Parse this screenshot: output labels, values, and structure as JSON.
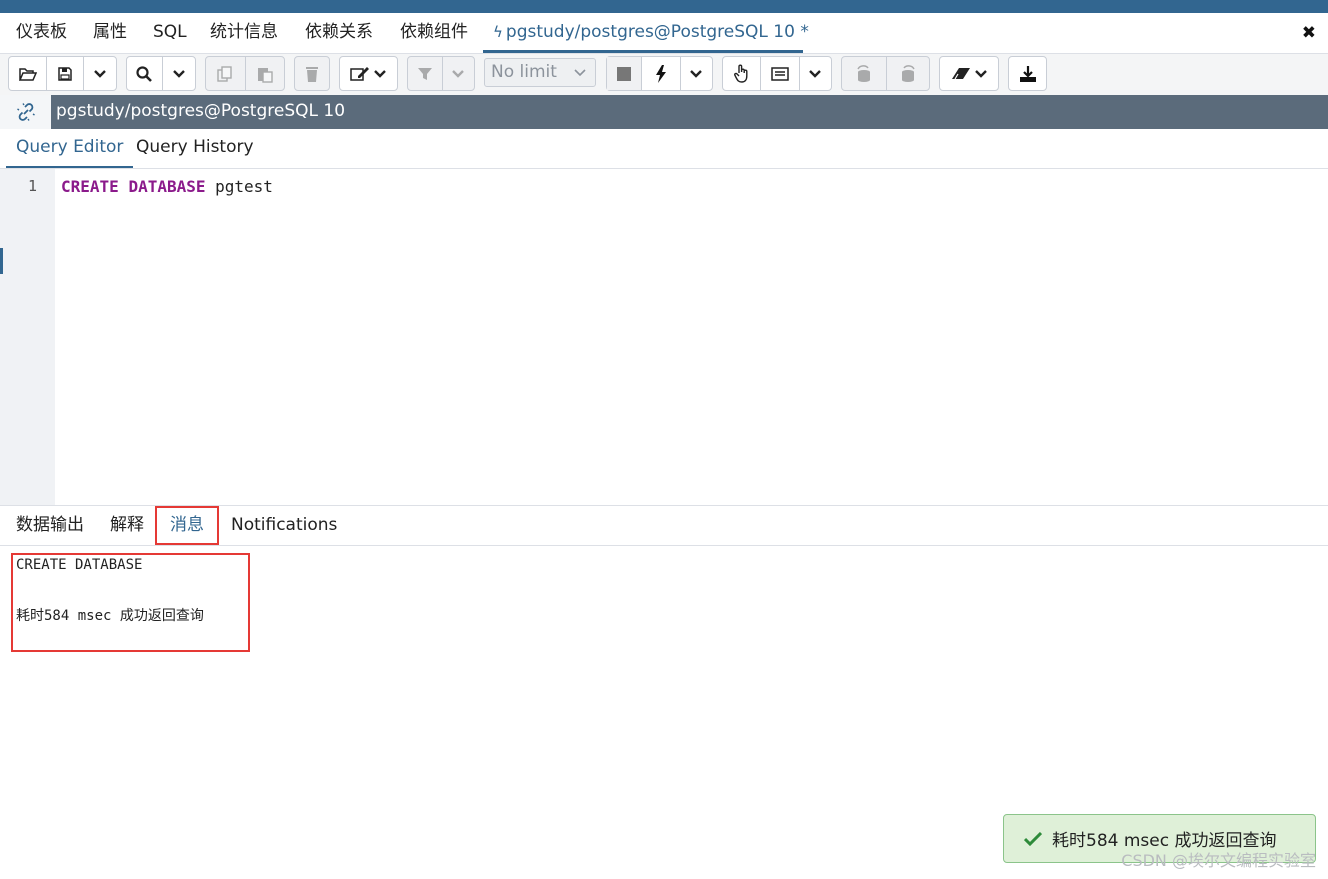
{
  "main_tabs": {
    "dashboard": "仪表板",
    "properties": "属性",
    "sql": "SQL",
    "statistics": "统计信息",
    "dependencies": "依赖关系",
    "dependents": "依赖组件",
    "query_tab": "pgstudy/postgres@PostgreSQL 10 *"
  },
  "toolbar": {
    "limit_value": "No limit",
    "icons": [
      "folder-open-icon",
      "save-icon",
      "chevron-down-icon",
      "search-icon",
      "chevron-down-icon",
      "copy-icon",
      "paste-icon",
      "delete-icon",
      "edit-icon",
      "chevron-down-icon",
      "filter-icon",
      "chevron-down-icon",
      "stop-icon",
      "execute-bolt-icon",
      "chevron-down-icon",
      "explain-hand-icon",
      "explain-analyze-icon",
      "chevron-down-icon",
      "commit-icon",
      "rollback-icon",
      "clear-eraser-icon",
      "chevron-down-icon",
      "download-icon"
    ]
  },
  "connection": {
    "title": "pgstudy/postgres@PostgreSQL 10"
  },
  "editor_tabs": {
    "query_editor": "Query Editor",
    "query_history": "Query History"
  },
  "editor": {
    "line_number": "1",
    "keyword1": "CREATE",
    "keyword2": "DATABASE",
    "identifier": "pgtest"
  },
  "result_tabs": {
    "data_output": "数据输出",
    "explain": "解释",
    "messages": "消息",
    "notifications": "Notifications"
  },
  "messages": {
    "line1": "CREATE DATABASE",
    "line2": "耗时584 msec 成功返回查询"
  },
  "toast": {
    "text": "耗时584 msec 成功返回查询"
  },
  "watermark": "CSDN @埃尔文编程实验室",
  "colors": {
    "accent": "#326690",
    "conn_bar": "#5b6b7b",
    "keyword": "#8b1a8b",
    "highlight_red": "#e53935",
    "toast_bg": "#dff0d8"
  }
}
